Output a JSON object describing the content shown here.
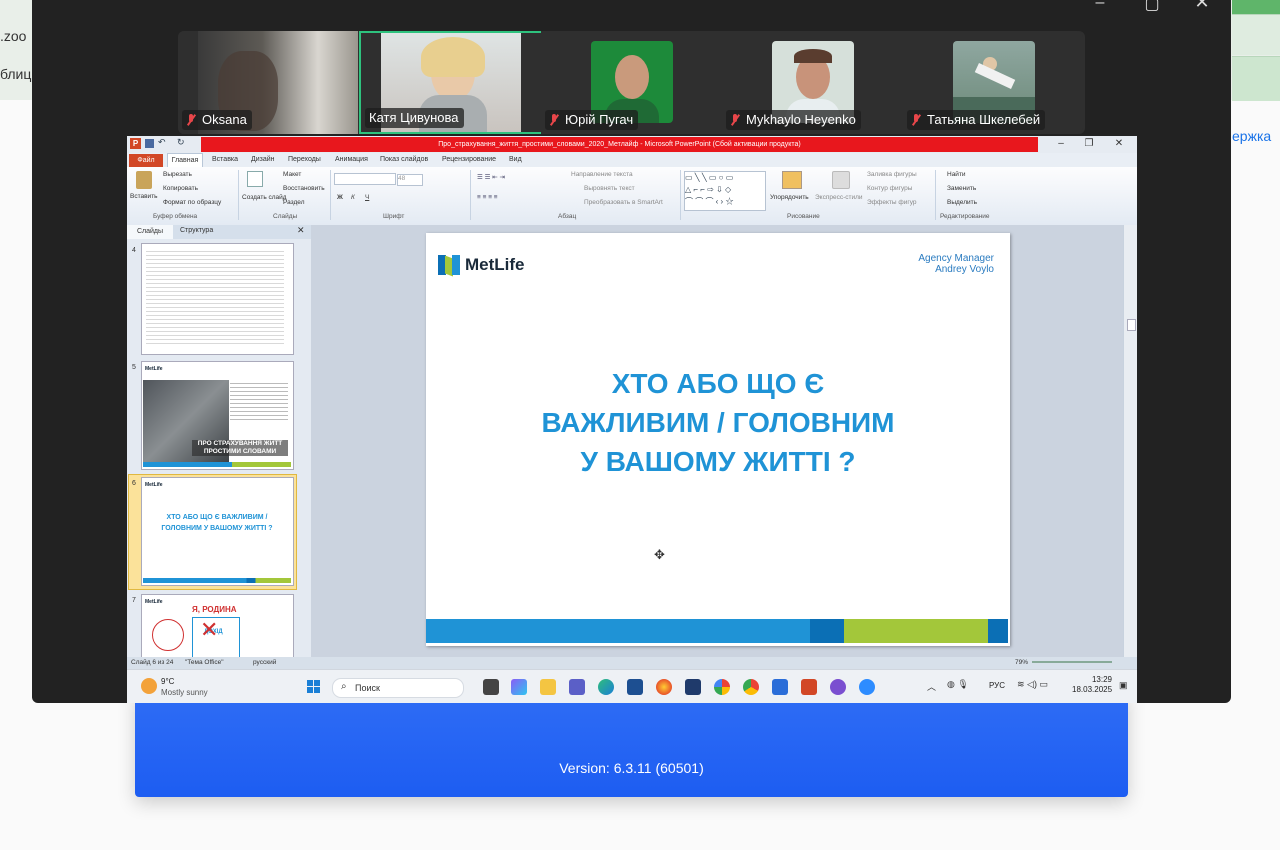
{
  "background": {
    "text1": ".zoo",
    "text2": "блиц",
    "right_link": "ержка"
  },
  "launcher": {
    "version": "Version: 6.3.11 (60501)"
  },
  "participants": [
    {
      "name": "Oksana",
      "muted": true,
      "active": false
    },
    {
      "name": "Катя Цивунова",
      "muted": false,
      "active": true
    },
    {
      "name": "Юрій Пугач",
      "muted": true,
      "active": false
    },
    {
      "name": "Mykhaylo Heyenko",
      "muted": true,
      "active": false
    },
    {
      "name": "Татьяна Шкелебей",
      "muted": true,
      "active": false
    }
  ],
  "ppt": {
    "title": "Про_страхування_життя_простими_словами_2020_Метлайф  -  Microsoft PowerPoint (Сбой активации продукта)",
    "tabs": {
      "file": "Файл",
      "home": "Главная",
      "others": [
        "Вставка",
        "Дизайн",
        "Переходы",
        "Анимация",
        "Показ слайдов",
        "Рецензирование",
        "Вид"
      ]
    },
    "ribbon": {
      "cut": "Вырезать",
      "copy": "Копировать",
      "format_painter": "Формат по образцу",
      "paste": "Вставить",
      "clipboard_group": "Буфер обмена",
      "layout": "Макет",
      "reset": "Восстановить",
      "section": "Раздел",
      "new_slide": "Создать слайд",
      "slides_group": "Слайды",
      "font_size": "48",
      "font_group": "Шрифт",
      "text_direction": "Направление текста",
      "align_text": "Выровнять текст",
      "smartart": "Преобразовать в SmartArt",
      "paragraph_group": "Абзац",
      "arrange": "Упорядочить",
      "quick_styles": "Экспресс-стили",
      "shape_fill": "Заливка фигуры",
      "shape_outline": "Контур фигуры",
      "shape_effects": "Эффекты фигур",
      "drawing_group": "Рисование",
      "find": "Найти",
      "replace": "Заменить",
      "select": "Выделить",
      "editing_group": "Редактирование"
    },
    "panel": {
      "tab_slides": "Слайды",
      "tab_outline": "Структура",
      "slide_numbers": [
        "4",
        "5",
        "6",
        "7"
      ],
      "thumb5_caption": "ПРО СТРАХУВАННЯ ЖИТТ ПРОСТИМИ СЛОВАМИ",
      "thumb6_caption": "ХТО АБО ЩО Є ВАЖЛИВИМ / ГОЛОВНИМ У ВАШОМУ ЖИТТІ ?",
      "thumb7_caption": "Я, РОДИНА",
      "thumb7_box": "ДОХІД"
    },
    "slide": {
      "logo": "MetLife",
      "agency_line1": "Agency Manager",
      "agency_line2": "Andrey Voylo",
      "title_lines": [
        "ХТО АБО ЩО Є",
        "ВАЖЛИВИМ / ГОЛОВНИМ",
        "У ВАШОМУ ЖИТТІ ?"
      ],
      "colors": {
        "accent": "#1f93d6",
        "brand_blue": "#0b6fb5",
        "brand_green": "#a3c73a"
      }
    },
    "status": {
      "slide_info": "Слайд 6 из 24",
      "theme": "\"Тема Office\"",
      "language": "русский",
      "zoom": "79%"
    }
  },
  "taskbar": {
    "weather_temp": "9°C",
    "weather_desc": "Mostly sunny",
    "search": "Поиск",
    "lang": "РУС",
    "time": "13:29",
    "date": "18.03.2025"
  }
}
